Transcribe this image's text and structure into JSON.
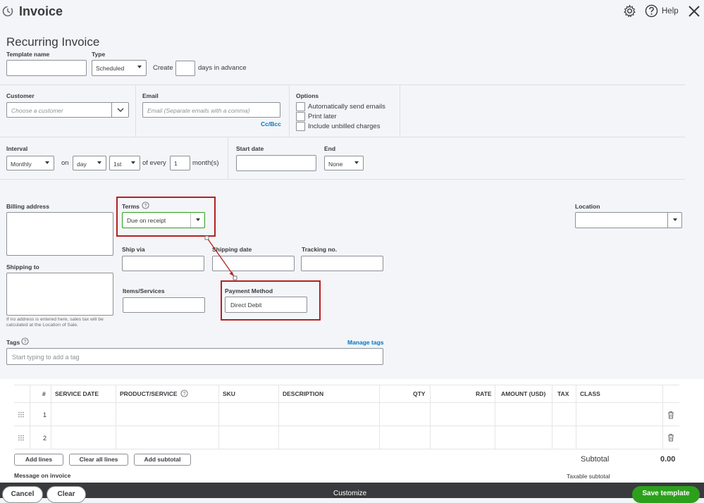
{
  "header": {
    "title": "Invoice",
    "help_label": "Help"
  },
  "form": {
    "subtitle": "Recurring Invoice",
    "template_name_label": "Template name",
    "type_label": "Type",
    "type_value": "Scheduled",
    "create_label": "Create",
    "days_in_advance_label": "days in advance",
    "customer_label": "Customer",
    "customer_placeholder": "Choose a customer",
    "email_label": "Email",
    "email_placeholder": "Email (Separate emails with a comma)",
    "ccbcc_label": "Cc/Bcc",
    "options_label": "Options",
    "options": [
      "Automatically send emails",
      "Print later",
      "Include unbilled charges"
    ],
    "interval_label": "Interval",
    "interval_value": "Monthly",
    "on_label": "on",
    "day_value": "day",
    "date_value": "1st",
    "of_every_label": "of every",
    "every_value": "1",
    "months_label": "month(s)",
    "start_date_label": "Start date",
    "end_label": "End",
    "end_value": "None",
    "billing_address_label": "Billing address",
    "terms_label": "Terms",
    "terms_value": "Due on receipt",
    "location_label": "Location",
    "shipping_to_label": "Shipping to",
    "ship_via_label": "Ship via",
    "shipping_date_label": "Shipping date",
    "tracking_label": "Tracking no.",
    "items_services_label": "Items/Services",
    "payment_method_label": "Payment Method",
    "payment_method_value": "Direct Debit",
    "address_note_1": "If no address is entered here, sales tax will be",
    "address_note_2": "calculated at the Location of Sale.",
    "tags_label": "Tags",
    "manage_tags_label": "Manage tags",
    "tags_placeholder": "Start typing to add a tag"
  },
  "table": {
    "headers": {
      "num": "#",
      "service_date": "SERVICE DATE",
      "product_service": "PRODUCT/SERVICE",
      "sku": "SKU",
      "description": "DESCRIPTION",
      "qty": "QTY",
      "rate": "RATE",
      "amount": "AMOUNT (USD)",
      "tax": "TAX",
      "class": "CLASS"
    },
    "rows": [
      {
        "num": "1"
      },
      {
        "num": "2"
      }
    ],
    "add_lines_label": "Add lines",
    "clear_all_lines_label": "Clear all lines",
    "add_subtotal_label": "Add subtotal",
    "subtotal_label": "Subtotal",
    "subtotal_value": "0.00",
    "message_label": "Message on invoice",
    "taxable_subtotal_label": "Taxable subtotal"
  },
  "footer": {
    "cancel_label": "Cancel",
    "clear_label": "Clear",
    "customize_label": "Customize",
    "save_label": "Save template"
  },
  "colors": {
    "accent_green": "#2ca01c",
    "link_blue": "#0077c5",
    "highlight_red": "#b22222",
    "footer_bg": "#393a3d"
  }
}
